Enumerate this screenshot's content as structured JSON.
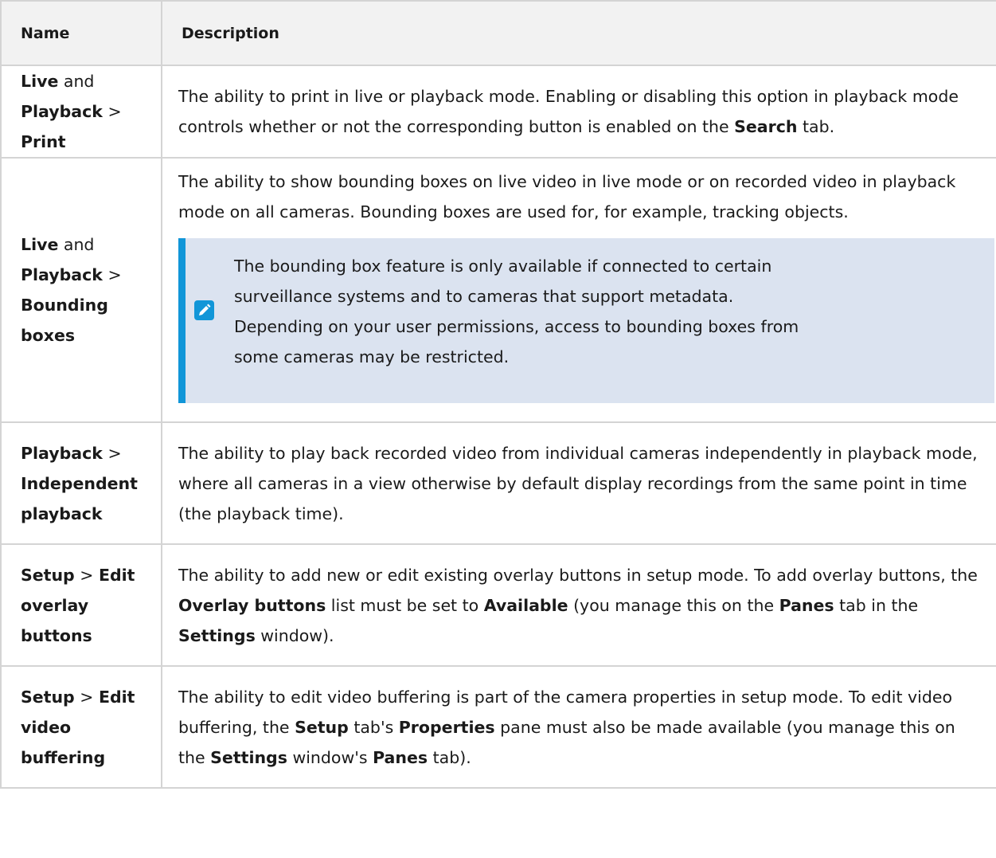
{
  "table": {
    "header": {
      "name": "Name",
      "description": "Description"
    },
    "rows": [
      {
        "name": [
          {
            "text": "Live",
            "bold": true
          },
          {
            "text": " and ",
            "bold": false
          },
          {
            "text": "Playback",
            "bold": true
          },
          {
            "text": " > ",
            "bold": false
          },
          {
            "text": "Print",
            "bold": true
          }
        ],
        "description": [
          {
            "text": "The ability to print in live or playback mode. Enabling or disabling this option in playback mode controls whether or not the corresponding button is enabled on the ",
            "bold": false
          },
          {
            "text": "Search",
            "bold": true
          },
          {
            "text": " tab.",
            "bold": false
          }
        ]
      },
      {
        "name": [
          {
            "text": "Live",
            "bold": true
          },
          {
            "text": " and ",
            "bold": false
          },
          {
            "text": "Playback",
            "bold": true
          },
          {
            "text": " > ",
            "bold": false
          },
          {
            "text": "Bounding boxes",
            "bold": true
          }
        ],
        "description": [
          {
            "text": "The ability to show bounding boxes on live video in live mode or on recorded video in playback mode on all cameras. Bounding boxes are used for, for example, tracking objects.",
            "bold": false
          }
        ],
        "note": {
          "icon": "pencil-icon",
          "text": "The bounding box feature is only available if connected to certain surveillance systems and to cameras that support metadata. Depending on your user permissions, access to bounding boxes from some cameras may be restricted."
        }
      },
      {
        "name": [
          {
            "text": "Playback",
            "bold": true
          },
          {
            "text": " > ",
            "bold": false
          },
          {
            "text": "Independent playback",
            "bold": true
          }
        ],
        "description": [
          {
            "text": "The ability to play back recorded video from individual cameras independently in playback mode, where all cameras in a view otherwise by default display recordings from the same point in time (the playback time).",
            "bold": false
          }
        ]
      },
      {
        "name": [
          {
            "text": "Setup",
            "bold": true
          },
          {
            "text": " > ",
            "bold": false
          },
          {
            "text": "Edit overlay buttons",
            "bold": true
          }
        ],
        "description": [
          {
            "text": "The ability to add new or edit existing overlay buttons in setup mode. To add overlay buttons, the ",
            "bold": false
          },
          {
            "text": "Overlay buttons",
            "bold": true
          },
          {
            "text": " list must be set to ",
            "bold": false
          },
          {
            "text": "Available",
            "bold": true
          },
          {
            "text": " (you manage this on the ",
            "bold": false
          },
          {
            "text": "Panes",
            "bold": true
          },
          {
            "text": " tab in the ",
            "bold": false
          },
          {
            "text": "Settings",
            "bold": true
          },
          {
            "text": " window).",
            "bold": false
          }
        ]
      },
      {
        "name": [
          {
            "text": "Setup",
            "bold": true
          },
          {
            "text": " > ",
            "bold": false
          },
          {
            "text": "Edit video buffering",
            "bold": true
          }
        ],
        "description": [
          {
            "text": "The ability to edit video buffering is part of the camera properties in setup mode. To edit video buffering, the ",
            "bold": false
          },
          {
            "text": "Setup",
            "bold": true
          },
          {
            "text": " tab's ",
            "bold": false
          },
          {
            "text": "Properties",
            "bold": true
          },
          {
            "text": " pane must also be made available (you manage this on the ",
            "bold": false
          },
          {
            "text": "Settings",
            "bold": true
          },
          {
            "text": " window's ",
            "bold": false
          },
          {
            "text": "Panes",
            "bold": true
          },
          {
            "text": " tab).",
            "bold": false
          }
        ]
      }
    ]
  },
  "colors": {
    "header_bg": "#f2f2f2",
    "border": "#d4d4d4",
    "note_bg": "#dbe3f0",
    "note_accent": "#1196d8"
  }
}
